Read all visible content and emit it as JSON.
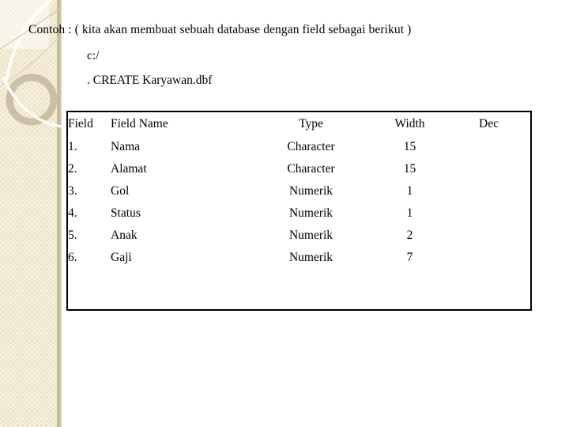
{
  "slide": {
    "title_line": "Contoh : ( kita akan membuat sebuah database dengan field sebagai berikut )",
    "path_line": "c:/",
    "command_line": ". CREATE Karyawan.dbf"
  },
  "field_table": {
    "headers": [
      "Field",
      "Field Name",
      "Type",
      "Width",
      "Dec"
    ],
    "rows": [
      {
        "field": "1.",
        "name": "Nama",
        "type": "Character",
        "width": "15",
        "dec": ""
      },
      {
        "field": "2.",
        "name": "Alamat",
        "type": "Character",
        "width": "15",
        "dec": ""
      },
      {
        "field": "3.",
        "name": "Gol",
        "type": "Numerik",
        "width": "1",
        "dec": ""
      },
      {
        "field": "4.",
        "name": "Status",
        "type": "Numerik",
        "width": "1",
        "dec": ""
      },
      {
        "field": "5.",
        "name": "Anak",
        "type": "Numerik",
        "width": "2",
        "dec": ""
      },
      {
        "field": "6.",
        "name": "Gaji",
        "type": "Numerik",
        "width": "7",
        "dec": ""
      }
    ]
  },
  "decoration": {
    "band_color": "#EFE3C6",
    "edge_color": "#CABD9C",
    "top_block_color": "#F7F1E3",
    "ring_color": "#C4B89B",
    "arc_light_color": "#FFFFFF"
  },
  "page": {
    "background_color": "#FFFFFF",
    "text_color": "#000000",
    "table_border_color": "#000000"
  }
}
